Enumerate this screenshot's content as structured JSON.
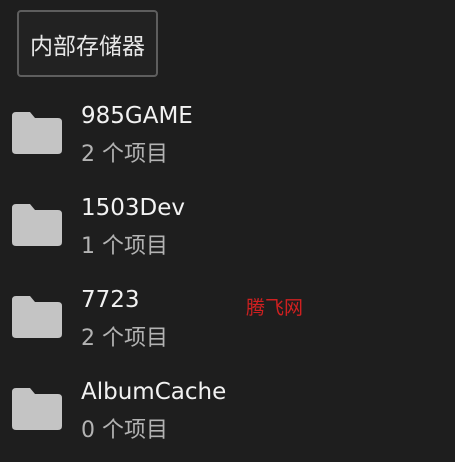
{
  "storage_button": {
    "label": "内部存储器"
  },
  "folders": [
    {
      "name": "985GAME",
      "count": "2 个项目"
    },
    {
      "name": "1503Dev",
      "count": "1 个项目"
    },
    {
      "name": "7723",
      "count": "2 个项目"
    },
    {
      "name": "AlbumCache",
      "count": "0 个项目"
    }
  ],
  "watermark": "腾飞网",
  "colors": {
    "background": "#1e1e1e",
    "folder_icon": "#c4c4c4",
    "watermark": "#d02020"
  },
  "icons": {
    "folder": "folder-icon"
  }
}
